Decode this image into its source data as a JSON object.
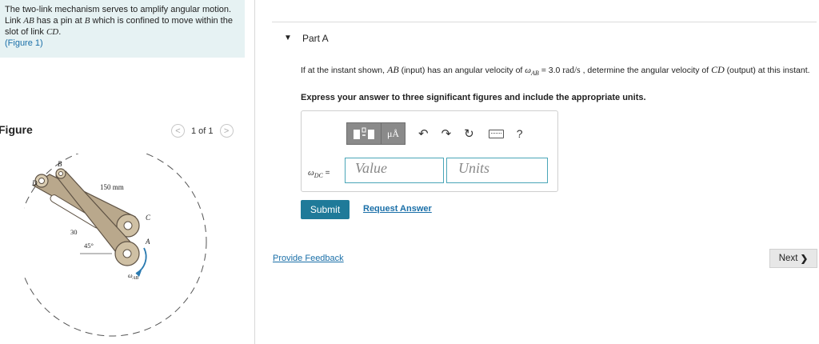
{
  "problem": {
    "text_1": "The two-link mechanism serves to amplify angular motion. Link ",
    "ab": "AB",
    "text_2": " has a pin at ",
    "b": "B",
    "text_3": " which is confined to move within the slot of link ",
    "cd": "CD",
    "text_4": ".",
    "figure_link": "(Figure 1)"
  },
  "figure_panel": {
    "title": "Figure",
    "pager": "1 of 1",
    "labels": {
      "B": "B",
      "D": "D",
      "C": "C",
      "A": "A",
      "dim": "150 mm",
      "angle30": "30",
      "angle45": "45°",
      "omega": "ω",
      "omega_sub": "AB"
    }
  },
  "part": {
    "label": "Part A",
    "question_1": "If at the instant shown, ",
    "q_ab": "AB",
    "question_2": " (input) has an angular velocity of ",
    "q_omega": "ω",
    "q_omega_sub": "AB",
    "question_3": " = 3.0 ",
    "q_units": "rad/s",
    "question_4": " , determine the angular velocity of ",
    "q_cd": "CD",
    "question_5": " (output) at this instant.",
    "instruction": "Express your answer to three significant figures and include the appropriate units."
  },
  "answer": {
    "toolbar": {
      "mu_label": "μÅ",
      "help": "?"
    },
    "var_omega": "ω",
    "var_sub": "DC",
    "equals": " =",
    "value_placeholder": "Value",
    "units_placeholder": "Units"
  },
  "buttons": {
    "submit": "Submit",
    "request_answer": "Request Answer",
    "provide_feedback": "Provide Feedback",
    "next": "Next"
  },
  "colors": {
    "accent": "#1f7a99",
    "link": "#1a6fa8",
    "problem_bg": "#e6f2f3",
    "link_body": "#b9a88c"
  }
}
